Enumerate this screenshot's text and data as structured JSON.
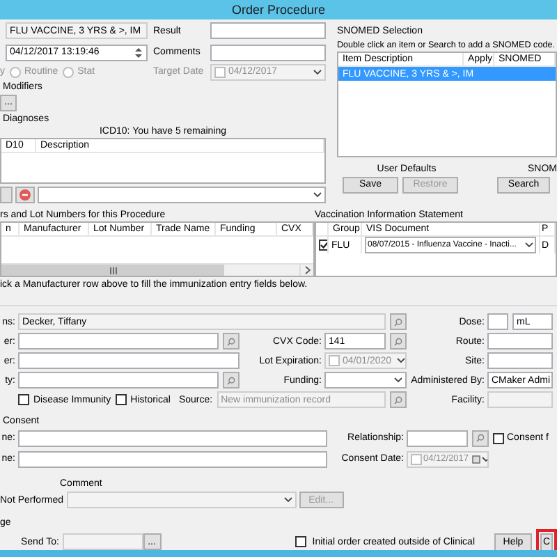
{
  "window": {
    "title": "Order Procedure"
  },
  "procedure": {
    "name": "FLU VACCINE, 3 YRS & >, IM",
    "datetime": "04/12/2017 13:19:46",
    "priority_label": "y",
    "priorities": [
      {
        "label": "Routine",
        "selected": false
      },
      {
        "label": "Stat",
        "selected": false
      }
    ],
    "result_label": "Result",
    "comments_label": "Comments",
    "target_date_label": "Target Date",
    "target_date": {
      "value": "04/12/2017",
      "checked": false
    },
    "modifiers_label": "Modifiers",
    "modifiers_button": "..."
  },
  "diagnoses": {
    "title": "Diagnoses",
    "remaining": "ICD10: You have 5 remaining",
    "columns": [
      "D10",
      "Description"
    ]
  },
  "snomed": {
    "title": "SNOMED Selection",
    "hint": "Double click an item or Search to add a SNOMED code.",
    "columns": [
      "Item Description",
      "Apply",
      "SNOMED"
    ],
    "rows": [
      {
        "item_description": "FLU VACCINE, 3 YRS & >, IM",
        "selected": true
      }
    ]
  },
  "user_defaults": {
    "title": "User Defaults",
    "buttons": [
      {
        "label": "Save",
        "disabled": false
      },
      {
        "label": "Restore",
        "disabled": true
      }
    ]
  },
  "snomed_search": {
    "title": "SNOM",
    "button": "Search"
  },
  "lots": {
    "title": "rs and Lot Numbers for this Procedure",
    "columns": [
      "n",
      "Manufacturer",
      "Lot Number",
      "Trade Name",
      "Funding",
      "CVX"
    ],
    "hint": "ick a Manufacturer row above to fill the immunization entry fields below."
  },
  "vis": {
    "title": "Vaccination Information Statement",
    "columns": [
      "Group",
      "VIS Document",
      "P"
    ],
    "rows": [
      {
        "checked": true,
        "group": "FLU",
        "document": "08/07/2015 - Influenza Vaccine - Inacti...",
        "column_4": "D"
      }
    ]
  },
  "left_fields": [
    {
      "label": "ns:",
      "value": "Decker, Tiffany",
      "search": true
    },
    {
      "label": "er:",
      "search": true
    },
    {
      "label": "er:",
      "search": false
    },
    {
      "label": "ty:",
      "search": true
    }
  ],
  "middle_fields": [
    {
      "label": "CVX Code:",
      "kind": "lookup",
      "value": "141"
    },
    {
      "label": "Lot Expiration:",
      "kind": "date",
      "value": "04/01/2020",
      "checked": false
    },
    {
      "label": "Funding:",
      "kind": "dropdown"
    }
  ],
  "right_fields": [
    {
      "label": "Dose:",
      "unit": "mL"
    },
    {
      "label": "Route:"
    },
    {
      "label": "Site:"
    },
    {
      "label": "Administered By:",
      "value": "CMaker Admi"
    },
    {
      "label": "Facility:"
    }
  ],
  "options": [
    {
      "label": "Disease Immunity",
      "checked": false
    },
    {
      "label": "Historical",
      "checked": false
    }
  ],
  "source": {
    "label": "Source:",
    "value": "New immunization record"
  },
  "consent": {
    "title": "Consent",
    "fields": [
      {
        "label": "ne:"
      },
      {
        "label": "ne:"
      }
    ],
    "relationship_label": "Relationship:",
    "consent_date": {
      "label": "Consent Date:",
      "value": "04/12/2017",
      "checked": false
    },
    "consent_form": {
      "label": "Consent f",
      "checked": false
    }
  },
  "not_performed": {
    "comment_label": "Comment",
    "label": "Not Performed",
    "edit_button": "Edit..."
  },
  "charge": {
    "title": "ge",
    "send_to_label": "Send To:",
    "browse_button": "..."
  },
  "footer": {
    "initial_order": {
      "label": "Initial order created outside of Clinical",
      "checked": false
    },
    "buttons": [
      {
        "label": "Help",
        "highlighted": false
      },
      {
        "label": "C",
        "highlighted": true
      }
    ]
  }
}
